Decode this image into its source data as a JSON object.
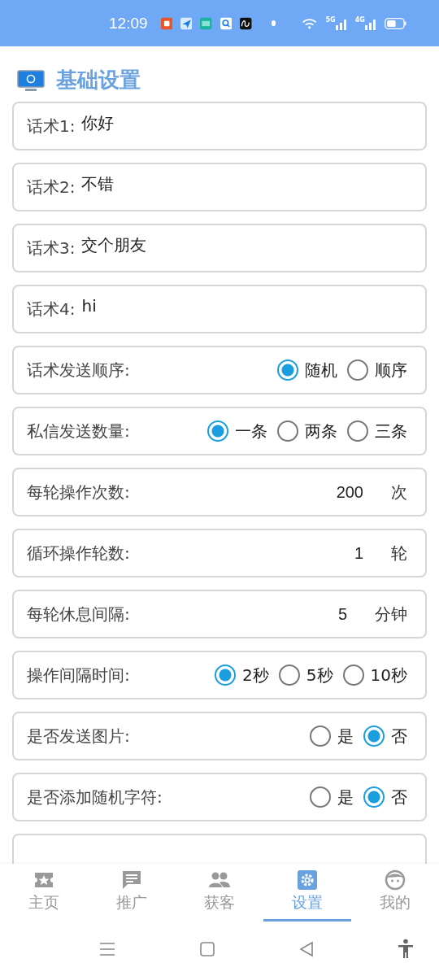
{
  "status_bar": {
    "time": "12:09",
    "networks": [
      "5G",
      "4G"
    ]
  },
  "section": {
    "title": "基础设置"
  },
  "rows": [
    {
      "kind": "text",
      "label": "话术1:",
      "value": "你好"
    },
    {
      "kind": "text",
      "label": "话术2:",
      "value": "不错"
    },
    {
      "kind": "text",
      "label": "话术3:",
      "value": "交个朋友"
    },
    {
      "kind": "text",
      "label": "话术4:",
      "value": "hi"
    },
    {
      "kind": "radio",
      "label": "话术发送顺序:",
      "options": [
        {
          "label": "随机",
          "selected": true
        },
        {
          "label": "顺序",
          "selected": false
        }
      ]
    },
    {
      "kind": "radio",
      "label": "私信发送数量:",
      "options": [
        {
          "label": "一条",
          "selected": true
        },
        {
          "label": "两条",
          "selected": false
        },
        {
          "label": "三条",
          "selected": false
        }
      ]
    },
    {
      "kind": "number",
      "label": "每轮操作次数:",
      "value": "200",
      "unit": "次"
    },
    {
      "kind": "number",
      "label": "循环操作轮数:",
      "value": "1",
      "unit": "轮"
    },
    {
      "kind": "number",
      "label": "每轮休息间隔:",
      "value": "5",
      "unit": "分钟"
    },
    {
      "kind": "radio",
      "label": "操作间隔时间:",
      "options": [
        {
          "label": "2秒",
          "selected": true
        },
        {
          "label": "5秒",
          "selected": false
        },
        {
          "label": "10秒",
          "selected": false
        }
      ]
    },
    {
      "kind": "radio",
      "label": "是否发送图片:",
      "options": [
        {
          "label": "是",
          "selected": false
        },
        {
          "label": "否",
          "selected": true
        }
      ]
    },
    {
      "kind": "radio",
      "label": "是否添加随机字符:",
      "options": [
        {
          "label": "是",
          "selected": false
        },
        {
          "label": "否",
          "selected": true
        }
      ]
    }
  ],
  "tabs": [
    {
      "label": "主页",
      "selected": false
    },
    {
      "label": "推广",
      "selected": false
    },
    {
      "label": "获客",
      "selected": false
    },
    {
      "label": "设置",
      "selected": true
    },
    {
      "label": "我的",
      "selected": false
    }
  ]
}
